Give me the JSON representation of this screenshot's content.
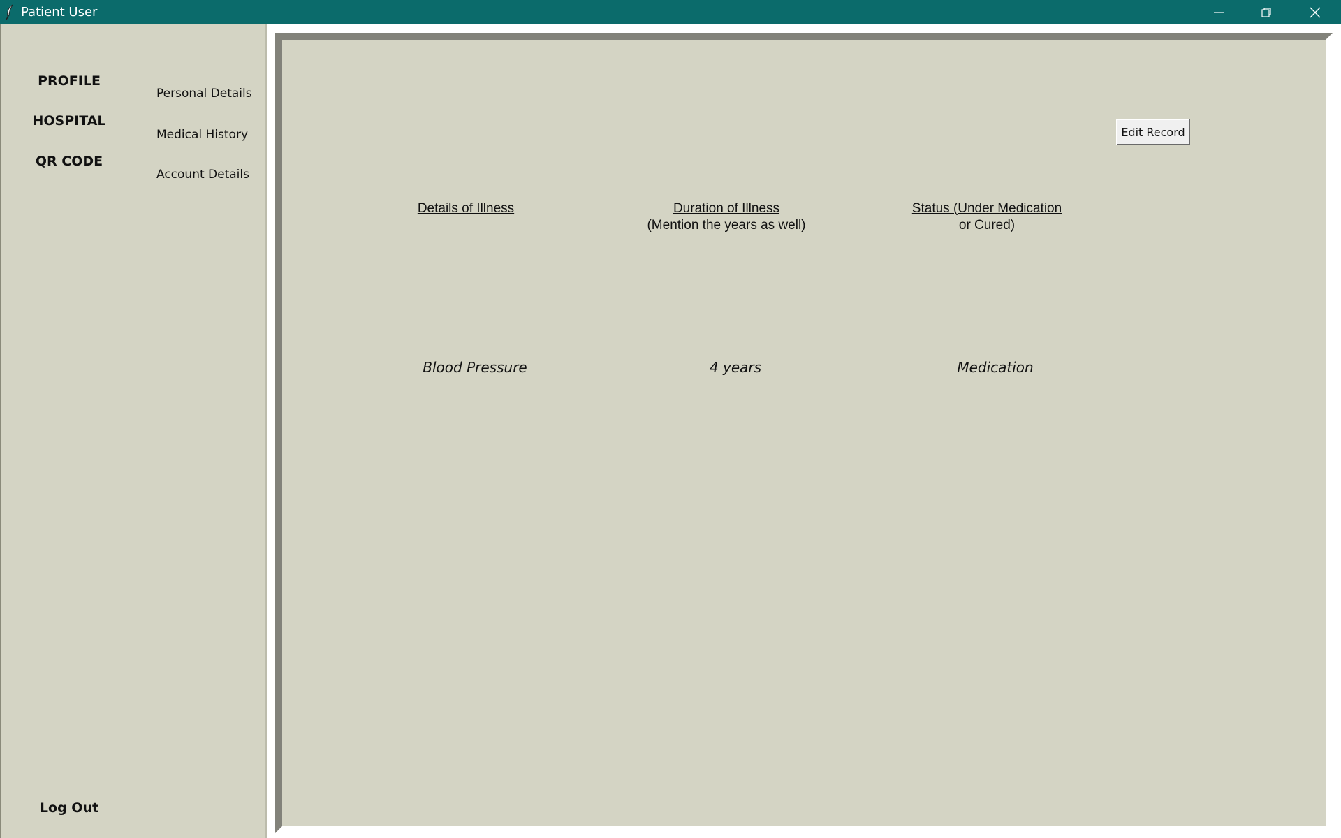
{
  "window": {
    "title": "Patient User"
  },
  "sidebar": {
    "main_items": [
      "PROFILE",
      "HOSPITAL",
      "QR CODE"
    ],
    "sub_items": [
      "Personal Details",
      "Medical History",
      "Account Details"
    ],
    "logout": "Log Out"
  },
  "toolbar": {
    "edit_label": "Edit Record"
  },
  "table": {
    "headers": [
      "Details of Illness",
      "Duration of Illness (Mention the years as well)",
      "Status (Under Medication or Cured)"
    ],
    "rows": [
      [
        "Blood Pressure",
        "4 years",
        "Medication"
      ]
    ]
  },
  "colors": {
    "titlebar": "#0b6b6b",
    "background": "#d4d4c4"
  },
  "icons": {
    "app": "feather-icon",
    "minimize": "minimize-icon",
    "maximize": "restore-icon",
    "close": "close-icon"
  }
}
